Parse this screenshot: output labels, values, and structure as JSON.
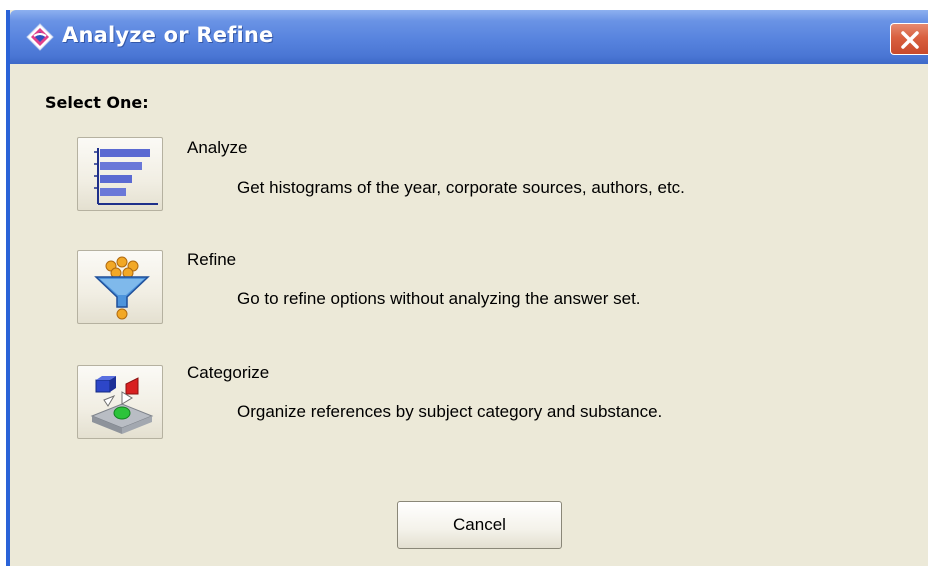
{
  "window": {
    "title": "Analyze or Refine",
    "title_icon": "app-diamond-icon",
    "close_icon": "close-x-icon"
  },
  "dialog": {
    "heading": "Select One:",
    "options": [
      {
        "title": "Analyze",
        "description": "Get histograms of the year, corporate sources, authors, etc.",
        "icon": "histogram-chart-icon"
      },
      {
        "title": "Refine",
        "description": "Go to refine options without analyzing the answer set.",
        "icon": "funnel-filter-icon"
      },
      {
        "title": "Categorize",
        "description": "Organize references by subject category and substance.",
        "icon": "category-shapes-icon"
      }
    ],
    "cancel_label": "Cancel"
  },
  "colors": {
    "titlebar": "#5783de",
    "dialog_bg": "#ece9d8",
    "close_button": "#d9603f",
    "histogram_bars": "#4f5fc8",
    "funnel": "#4a8fd8",
    "ball_orange": "#f0a020"
  }
}
